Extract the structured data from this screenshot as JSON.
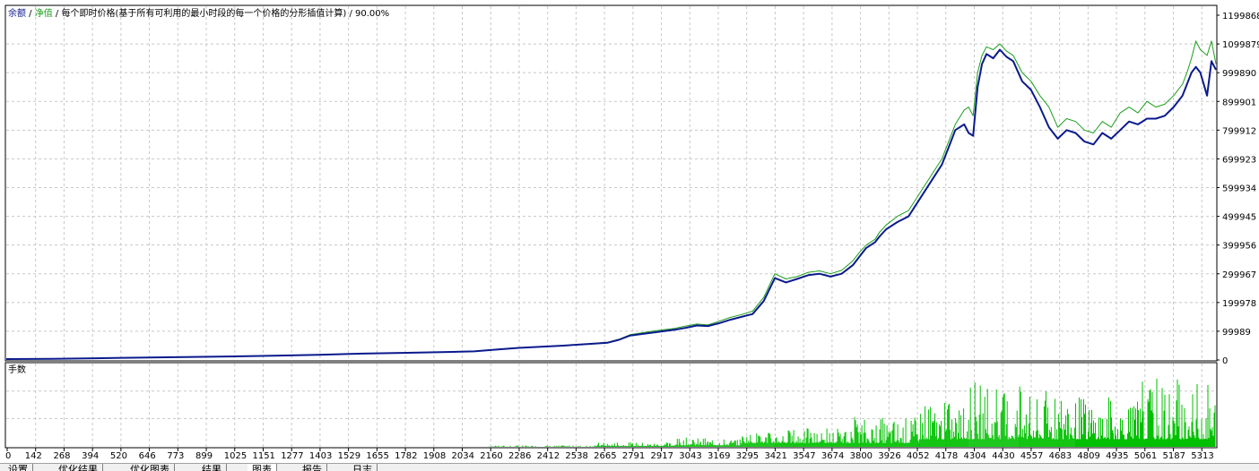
{
  "colors": {
    "balance": "#0a1a8c",
    "equity": "#1c9e1c",
    "lots": "#00c000",
    "grid": "#c8c8c8",
    "frame": "#000000",
    "legend_balance": "#0a1a8c",
    "legend_equity": "#1c9e1c",
    "legend_text": "#000000"
  },
  "legend": {
    "balance_label": "余额",
    "sep1": " / ",
    "equity_label": "净值",
    "sep2": " / ",
    "model_label": "每个即时价格(基于所有可利用的最小时段的每一个价格的分形插值计算)",
    "sep3": " / ",
    "quality_label": "90.00%"
  },
  "chart_data": [
    {
      "type": "line",
      "title": "",
      "ylim": [
        0,
        1199868
      ],
      "yticks": [
        "1199868",
        "1099879",
        "999890",
        "899901",
        "799912",
        "699923",
        "599934",
        "499945",
        "399956",
        "299967",
        "199978",
        "99989",
        "0"
      ],
      "xlim": [
        0,
        5430
      ],
      "grid": true,
      "series": [
        {
          "name": "净值",
          "x": [
            0,
            200,
            400,
            600,
            800,
            1000,
            1200,
            1400,
            1600,
            1800,
            2000,
            2100,
            2200,
            2300,
            2400,
            2500,
            2600,
            2700,
            2750,
            2800,
            2900,
            2950,
            3000,
            3050,
            3100,
            3150,
            3200,
            3250,
            3300,
            3350,
            3400,
            3450,
            3500,
            3550,
            3600,
            3650,
            3700,
            3750,
            3800,
            3830,
            3860,
            3900,
            3920,
            3950,
            4000,
            4050,
            4100,
            4150,
            4200,
            4230,
            4260,
            4300,
            4320,
            4340,
            4360,
            4380,
            4400,
            4430,
            4460,
            4490,
            4520,
            4560,
            4600,
            4640,
            4680,
            4720,
            4760,
            4800,
            4840,
            4880,
            4920,
            4960,
            5000,
            5040,
            5080,
            5120,
            5160,
            5200,
            5240,
            5280,
            5300,
            5320,
            5340,
            5360,
            5390,
            5410,
            5430
          ],
          "values": [
            3000,
            4000,
            6000,
            8000,
            10000,
            12000,
            15000,
            18000,
            22000,
            25000,
            28000,
            30000,
            36000,
            42000,
            46000,
            50000,
            55000,
            62000,
            72000,
            88000,
            100000,
            105000,
            110000,
            118000,
            125000,
            122000,
            135000,
            148000,
            158000,
            170000,
            218000,
            300000,
            282000,
            290000,
            305000,
            310000,
            300000,
            312000,
            345000,
            375000,
            400000,
            420000,
            445000,
            470000,
            500000,
            520000,
            580000,
            640000,
            700000,
            760000,
            820000,
            870000,
            880000,
            850000,
            1000000,
            1060000,
            1090000,
            1080000,
            1100000,
            1075000,
            1060000,
            1000000,
            970000,
            920000,
            880000,
            810000,
            840000,
            830000,
            800000,
            790000,
            830000,
            810000,
            860000,
            880000,
            860000,
            900000,
            880000,
            890000,
            920000,
            960000,
            1000000,
            1050000,
            1110000,
            1080000,
            1060000,
            1110000,
            1030000
          ]
        },
        {
          "name": "余额",
          "x": [
            0,
            200,
            400,
            600,
            800,
            1000,
            1200,
            1400,
            1600,
            1800,
            2000,
            2100,
            2200,
            2300,
            2400,
            2500,
            2600,
            2700,
            2750,
            2800,
            2900,
            2950,
            3000,
            3050,
            3100,
            3150,
            3200,
            3250,
            3300,
            3350,
            3400,
            3450,
            3500,
            3550,
            3600,
            3650,
            3700,
            3750,
            3800,
            3830,
            3860,
            3900,
            3920,
            3950,
            4000,
            4050,
            4100,
            4150,
            4200,
            4230,
            4260,
            4300,
            4320,
            4340,
            4360,
            4380,
            4400,
            4430,
            4460,
            4490,
            4520,
            4560,
            4600,
            4640,
            4680,
            4720,
            4760,
            4800,
            4840,
            4880,
            4920,
            4960,
            5000,
            5040,
            5080,
            5120,
            5160,
            5200,
            5240,
            5280,
            5300,
            5320,
            5340,
            5360,
            5390,
            5410,
            5430
          ],
          "values": [
            3000,
            4000,
            6000,
            8000,
            10000,
            12000,
            15000,
            18000,
            22000,
            25000,
            28000,
            30000,
            36000,
            42000,
            46000,
            50000,
            55000,
            60000,
            70000,
            85000,
            95000,
            100000,
            105000,
            112000,
            120000,
            118000,
            128000,
            140000,
            150000,
            160000,
            205000,
            285000,
            270000,
            282000,
            295000,
            300000,
            290000,
            300000,
            330000,
            360000,
            390000,
            410000,
            430000,
            455000,
            480000,
            500000,
            560000,
            620000,
            680000,
            740000,
            800000,
            820000,
            790000,
            780000,
            950000,
            1030000,
            1065000,
            1050000,
            1080000,
            1055000,
            1040000,
            970000,
            940000,
            880000,
            810000,
            770000,
            800000,
            790000,
            760000,
            750000,
            790000,
            770000,
            800000,
            830000,
            820000,
            840000,
            840000,
            850000,
            880000,
            920000,
            960000,
            1000000,
            1020000,
            1000000,
            920000,
            1040000,
            1010000
          ]
        }
      ]
    },
    {
      "type": "bar",
      "title": "手数",
      "xlabels": [
        "0",
        "142",
        "268",
        "394",
        "520",
        "646",
        "773",
        "899",
        "1025",
        "1151",
        "1277",
        "1403",
        "1529",
        "1655",
        "1782",
        "1908",
        "2034",
        "2160",
        "2286",
        "2412",
        "2538",
        "2665",
        "2791",
        "2917",
        "3043",
        "3169",
        "3295",
        "3421",
        "3547",
        "3674",
        "3800",
        "3926",
        "4052",
        "4178",
        "4304",
        "4430",
        "4557",
        "4683",
        "4809",
        "4935",
        "5061",
        "5187",
        "5313"
      ],
      "xlim": [
        0,
        5430
      ],
      "ylim": [
        0,
        100
      ],
      "segments": [
        {
          "x": [
            0,
            2150
          ],
          "min": 0,
          "max": 0
        },
        {
          "x": [
            2150,
            2650
          ],
          "min": 0,
          "max": 2
        },
        {
          "x": [
            2650,
            3000
          ],
          "min": 1,
          "max": 6
        },
        {
          "x": [
            3000,
            3300
          ],
          "min": 2,
          "max": 12
        },
        {
          "x": [
            3300,
            3450
          ],
          "min": 5,
          "max": 20
        },
        {
          "x": [
            3450,
            3800
          ],
          "min": 5,
          "max": 25
        },
        {
          "x": [
            3800,
            4100
          ],
          "min": 5,
          "max": 40
        },
        {
          "x": [
            4100,
            4320
          ],
          "min": 10,
          "max": 60
        },
        {
          "x": [
            4320,
            4550
          ],
          "min": 10,
          "max": 85
        },
        {
          "x": [
            4550,
            4800
          ],
          "min": 10,
          "max": 75
        },
        {
          "x": [
            4800,
            5100
          ],
          "min": 10,
          "max": 70
        },
        {
          "x": [
            5100,
            5430
          ],
          "min": 10,
          "max": 92
        }
      ]
    }
  ],
  "tabs": [
    {
      "label": "设置"
    },
    {
      "label": "优化结果"
    },
    {
      "label": "优化图表"
    },
    {
      "label": "结果"
    },
    {
      "label": "图表"
    },
    {
      "label": "报告"
    },
    {
      "label": "日志"
    }
  ]
}
